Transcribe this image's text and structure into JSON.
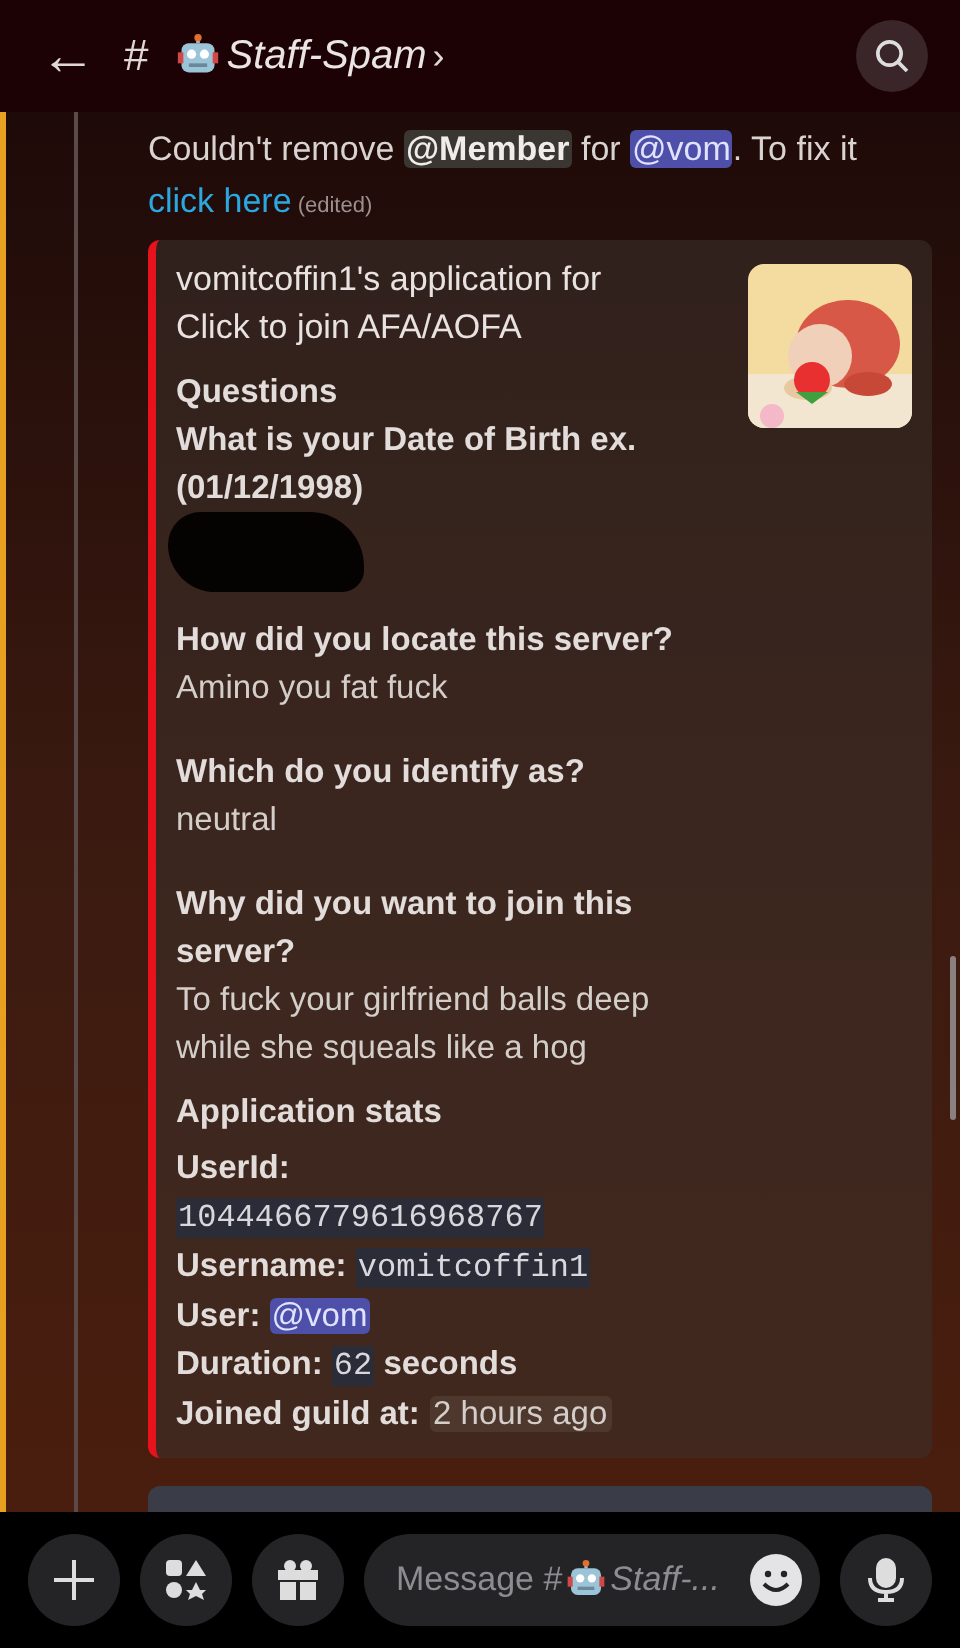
{
  "header": {
    "back": "←",
    "hash": "#",
    "channel": "Staff-Spam",
    "chevron": "›"
  },
  "message": {
    "segments": [
      {
        "kind": "text",
        "text": "Couldn't remove "
      },
      {
        "kind": "role",
        "text": "@Member"
      },
      {
        "kind": "text",
        "text": " for "
      },
      {
        "kind": "mention",
        "text": "@vom"
      },
      {
        "kind": "text",
        "text": ". To fix it"
      }
    ],
    "link": "click here",
    "edited": "(edited)"
  },
  "embed": {
    "title_lines": [
      "vomitcoffin1's application for",
      "Click to join AFA/AOFA"
    ],
    "sections": [
      {
        "heading": "Questions",
        "question": "What is your Date of Birth ex. (01/12/1998)",
        "redacted": true
      },
      {
        "question": "How did you locate this server?",
        "answer": "Amino you fat fuck",
        "redacted": false
      },
      {
        "question": "Which do you identify as?",
        "answer": "neutral",
        "redacted": false
      },
      {
        "question": "Why did you want to join this server?",
        "answer": "To fuck your girlfriend balls deep while she squeals like a hog",
        "redacted": false
      }
    ],
    "stats_heading": "Application stats",
    "stats": [
      {
        "label": "UserId:",
        "value": "1044466779616968767",
        "kind": "code",
        "own_line": true
      },
      {
        "label": "Username:",
        "value": "vomitcoffin1",
        "kind": "code",
        "own_line": false
      },
      {
        "label": "User:",
        "value": "@vom",
        "kind": "mention",
        "own_line": false
      },
      {
        "label": "Duration:",
        "value": "62",
        "kind": "code",
        "suffix": "seconds",
        "own_line": false
      },
      {
        "label": "Joined guild at:",
        "value": "2 hours ago",
        "kind": "timestamp",
        "own_line": false
      }
    ]
  },
  "composer": {
    "placeholder": "Message #",
    "placeholder_channel": "Staff-..."
  }
}
